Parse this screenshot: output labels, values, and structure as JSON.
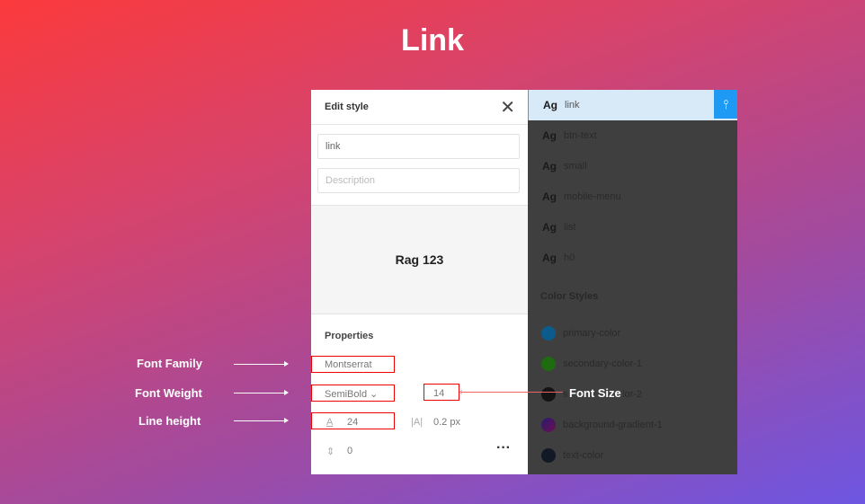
{
  "title": "Link",
  "edit_panel": {
    "header": "Edit style",
    "name_value": "link",
    "description_placeholder": "Description",
    "preview_text": "Rag 123",
    "properties_label": "Properties",
    "font_family": "Montserrat",
    "font_weight": "SemiBold",
    "font_size": "14",
    "line_height": "24",
    "letter_spacing": "0.2 px",
    "paragraph_spacing": "0"
  },
  "text_styles": [
    {
      "sample": "Ag",
      "name": "link"
    },
    {
      "sample": "Ag",
      "name": "btn-text"
    },
    {
      "sample": "Ag",
      "name": "small"
    },
    {
      "sample": "Ag",
      "name": "mobile-menu"
    },
    {
      "sample": "Ag",
      "name": "list"
    },
    {
      "sample": "Ag",
      "name": "h0"
    }
  ],
  "color_styles_label": "Color Styles",
  "color_styles": [
    {
      "name": "primary-color",
      "color": "#0b5b8c"
    },
    {
      "name": "secondary-color-1",
      "color": "#1f6b10"
    },
    {
      "name": "secondary-color-2",
      "color": "#141414"
    },
    {
      "name": "background-gradient-1",
      "color": "#4a1860"
    },
    {
      "name": "text-color",
      "color": "#121826"
    }
  ],
  "annotations": {
    "font_family": "Font Family",
    "font_weight": "Font Weight",
    "line_height": "Line height",
    "font_size": "Font Size"
  }
}
